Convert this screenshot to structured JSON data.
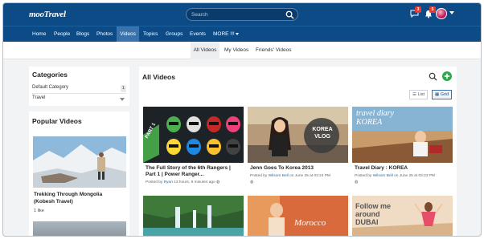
{
  "header": {
    "logo": "mooTravel",
    "search_placeholder": "Search",
    "messages_count": "3",
    "notifications_count": "5"
  },
  "nav": {
    "items": [
      "Home",
      "People",
      "Blogs",
      "Photos",
      "Videos",
      "Topics",
      "Groups",
      "Events",
      "MORE !!!"
    ],
    "active": "Videos"
  },
  "subtabs": [
    "All Videos",
    "My Videos",
    "Friends' Videos"
  ],
  "sidebar": {
    "categories_title": "Categories",
    "categories": [
      {
        "label": "Default Category",
        "count": "1"
      },
      {
        "label": "Travel",
        "count": ""
      }
    ],
    "popular_title": "Popular Videos",
    "popular": [
      {
        "title": "Trekking Through Mongolia (Kobesh Travel)",
        "likes": "1 like"
      }
    ]
  },
  "main": {
    "title": "All Videos",
    "view_list": "List",
    "view_grid": "Grid",
    "videos": [
      {
        "title": "The Full Story of the 6th Rangers | Part 1 | Power Ranger...",
        "posted_by": "Posted by",
        "author": "Ryan",
        "time": "13 hours, 9 minutes ago",
        "overlay": "PART 1"
      },
      {
        "title": "Jenn Goes To Korea 2013",
        "posted_by": "Posted by",
        "author": "Wilsom Bell",
        "time": "on June 25 at 03:24 PM",
        "overlay": "KOREA VLOG"
      },
      {
        "title": "Travel Diary : KOREA",
        "posted_by": "Posted by",
        "author": "Wilsom Bell",
        "time": "on June 25 at 03:23 PM",
        "overlay": "travel diary KOREA"
      },
      {
        "title": "",
        "overlay": ""
      },
      {
        "title": "",
        "overlay": "Morocco"
      },
      {
        "title": "",
        "overlay": "Follow me around DUBAI"
      }
    ]
  },
  "colors": {
    "header": "#0c4b86",
    "active_nav": "#3a73ac",
    "link": "#1e6bb8",
    "add_button": "#2ea84a"
  }
}
